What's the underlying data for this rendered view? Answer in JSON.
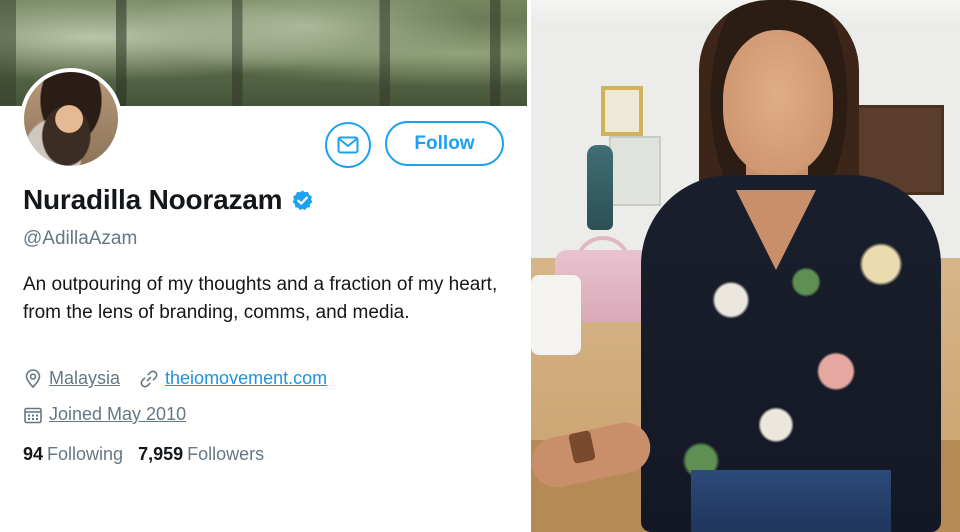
{
  "profile": {
    "display_name": "Nuradilla Noorazam",
    "handle": "@AdillaAzam",
    "bio": "An outpouring of my thoughts and a fraction of my heart, from the lens of branding, comms, and media.",
    "location": "Malaysia",
    "website": "theiomovement.com",
    "joined": "Joined May 2010",
    "following_count": "94",
    "following_label": "Following",
    "followers_count": "7,959",
    "followers_label": "Followers",
    "verified": true
  },
  "actions": {
    "follow_label": "Follow"
  },
  "icons": {
    "message": "envelope-icon",
    "verified": "verified-badge-icon",
    "location": "location-pin-icon",
    "website": "link-icon",
    "joined": "calendar-icon"
  },
  "colors": {
    "accent": "#1da1f2",
    "link": "#1b95e0",
    "text": "#14171a",
    "secondary_text": "#657786"
  }
}
